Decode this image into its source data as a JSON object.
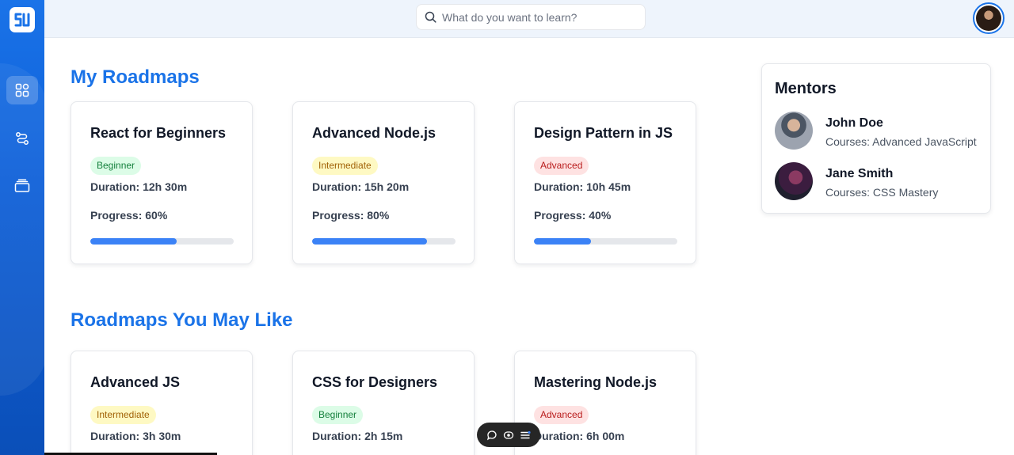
{
  "search": {
    "placeholder": "What do you want to learn?"
  },
  "sections": {
    "my_roadmaps": "My Roadmaps",
    "recommended": "Roadmaps You May Like"
  },
  "my_roadmaps": [
    {
      "title": "React for Beginners",
      "level": "Beginner",
      "duration": "Duration: 12h 30m",
      "progress_label": "Progress: 60%",
      "progress": 0.6
    },
    {
      "title": "Advanced Node.js",
      "level": "Intermediate",
      "duration": "Duration: 15h 20m",
      "progress_label": "Progress: 80%",
      "progress": 0.8
    },
    {
      "title": "Design Pattern in JS",
      "level": "Advanced",
      "duration": "Duration: 10h 45m",
      "progress_label": "Progress: 40%",
      "progress": 0.4
    }
  ],
  "recommended": [
    {
      "title": "Advanced JS",
      "level": "Intermediate",
      "duration": "Duration: 3h 30m"
    },
    {
      "title": "CSS for Designers",
      "level": "Beginner",
      "duration": "Duration: 2h 15m"
    },
    {
      "title": "Mastering Node.js",
      "level": "Advanced",
      "duration": "Duration: 6h 00m"
    }
  ],
  "mentors": {
    "title": "Mentors",
    "items": [
      {
        "name": "John Doe",
        "courses": "Courses: Advanced JavaScript"
      },
      {
        "name": "Jane Smith",
        "courses": "Courses: CSS Mastery"
      }
    ]
  },
  "colors": {
    "accent": "#1a73e8",
    "progress": "#3b82f6",
    "beginner_bg": "#dcfce7",
    "intermediate_bg": "#fef9c3",
    "advanced_bg": "#fee2e2"
  },
  "icons": {
    "logo": "logo-icon",
    "nav": [
      "dashboard-grid-icon",
      "roadmap-route-icon",
      "courses-stack-icon"
    ],
    "search": "search-icon",
    "float_bar": [
      "comment-icon",
      "view-toggle-icon",
      "menu-icon"
    ]
  }
}
